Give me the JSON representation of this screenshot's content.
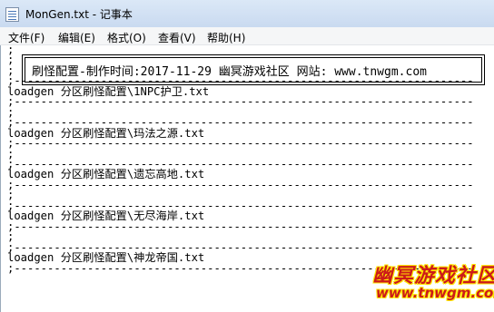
{
  "window": {
    "title": "MonGen.txt - 记事本",
    "icon": "notepad-icon"
  },
  "menu": {
    "items": [
      "文件(F)",
      "编辑(E)",
      "格式(O)",
      "查看(V)",
      "帮助(H)"
    ]
  },
  "editor": {
    "header": "刷怪配置-制作时间:2017-11-29 幽冥游戏社区 网站: www.tnwgm.com",
    "lines": [
      ";",
      ";",
      ";",
      ";---------------------------------------------------------------------",
      "loadgen 分区刷怪配置\\1NPC护卫.txt",
      ";---------------------------------------------------------------------",
      ";",
      ";---------------------------------------------------------------------",
      "loadgen 分区刷怪配置\\玛法之源.txt",
      ";---------------------------------------------------------------------",
      ";",
      ";---------------------------------------------------------------------",
      "loadgen 分区刷怪配置\\遗忘高地.txt",
      ";---------------------------------------------------------------------",
      ";",
      ";---------------------------------------------------------------------",
      "loadgen 分区刷怪配置\\无尽海岸.txt",
      ";---------------------------------------------------------------------",
      ";",
      ";---------------------------------------------------------------------",
      "loadgen 分区刷怪配置\\神龙帝国.txt",
      ";---------------------------------------------------------------------"
    ]
  },
  "watermark": {
    "text": "幽冥游戏社区",
    "url": "www.tnwgm.com",
    "color": "#cc1a1a"
  }
}
